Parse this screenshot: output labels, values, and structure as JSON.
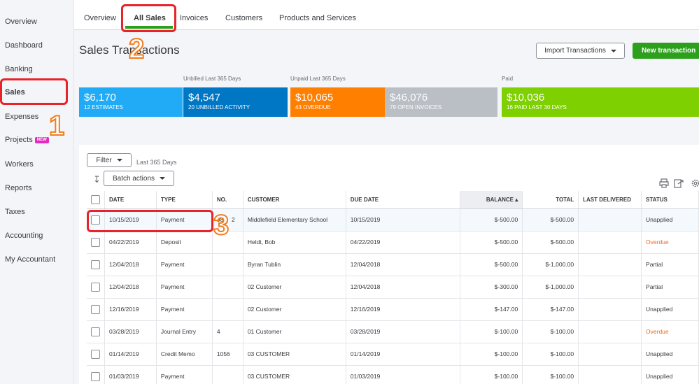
{
  "sidebar": {
    "items": [
      {
        "label": "Overview"
      },
      {
        "label": "Dashboard"
      },
      {
        "label": "Banking"
      },
      {
        "label": "Sales"
      },
      {
        "label": "Expenses"
      },
      {
        "label": "Projects",
        "badge": "NEW"
      },
      {
        "label": "Workers"
      },
      {
        "label": "Reports"
      },
      {
        "label": "Taxes"
      },
      {
        "label": "Accounting"
      },
      {
        "label": "My Accountant"
      }
    ]
  },
  "tabs": [
    "Overview",
    "All Sales",
    "Invoices",
    "Customers",
    "Products and Services"
  ],
  "page": {
    "title": "Sales Transactions",
    "import_label": "Import Transactions",
    "new_label": "New transaction"
  },
  "money_bar": {
    "labels": {
      "unbilled": "Unbilled Last 365 Days",
      "unpaid": "Unpaid Last 365 Days",
      "paid": "Paid"
    },
    "cards": [
      {
        "amount": "$6,170",
        "sub": "12 ESTIMATES",
        "color": "#21abf6"
      },
      {
        "amount": "$4,547",
        "sub": "20 UNBILLED ACTIVITY",
        "color": "#0077c5"
      },
      {
        "amount": "$10,065",
        "sub": "43 OVERDUE",
        "color": "#ff8000"
      },
      {
        "amount": "$46,076",
        "sub": "79 OPEN INVOICES",
        "color": "#babec5"
      },
      {
        "amount": "$10,036",
        "sub": "16 PAID LAST 30 DAYS",
        "color": "#7fd000"
      }
    ]
  },
  "filter": {
    "label": "Filter",
    "range": "Last 365 Days",
    "batch_label": "Batch actions"
  },
  "table": {
    "headers": {
      "date": "DATE",
      "type": "TYPE",
      "no": "NO.",
      "customer": "CUSTOMER",
      "due": "DUE DATE",
      "balance": "BALANCE",
      "total": "TOTAL",
      "delivered": "LAST DELIVERED",
      "status": "STATUS"
    },
    "rows": [
      {
        "date": "10/15/2019",
        "type": "Payment",
        "no": "980",
        "no_suffix": "2",
        "customer": "Middlefield Elementary School",
        "due": "10/15/2019",
        "balance": "$-500.00",
        "total": "$-500.00",
        "delivered": "",
        "status": "Unapplied"
      },
      {
        "date": "04/22/2019",
        "type": "Deposit",
        "no": "",
        "customer": "Heldt, Bob",
        "due": "04/22/2019",
        "balance": "$-500.00",
        "total": "$-500.00",
        "delivered": "",
        "status": "Overdue"
      },
      {
        "date": "12/04/2018",
        "type": "Payment",
        "no": "",
        "customer": "Byran Tublin",
        "due": "12/04/2018",
        "balance": "$-500.00",
        "total": "$-1,000.00",
        "delivered": "",
        "status": "Partial"
      },
      {
        "date": "12/04/2018",
        "type": "Payment",
        "no": "",
        "customer": "02 Customer",
        "due": "12/04/2018",
        "balance": "$-300.00",
        "total": "$-1,000.00",
        "delivered": "",
        "status": "Partial"
      },
      {
        "date": "12/16/2019",
        "type": "Payment",
        "no": "",
        "customer": "02 Customer",
        "due": "12/16/2019",
        "balance": "$-147.00",
        "total": "$-147.00",
        "delivered": "",
        "status": "Unapplied"
      },
      {
        "date": "03/28/2019",
        "type": "Journal Entry",
        "no": "4",
        "customer": "01 Customer",
        "due": "03/28/2019",
        "balance": "$-100.00",
        "total": "$-100.00",
        "delivered": "",
        "status": "Overdue"
      },
      {
        "date": "01/14/2019",
        "type": "Credit Memo",
        "no": "1056",
        "customer": "03 CUSTOMER",
        "due": "01/14/2019",
        "balance": "$-100.00",
        "total": "$-100.00",
        "delivered": "",
        "status": "Unapplied"
      },
      {
        "date": "01/03/2019",
        "type": "Payment",
        "no": "",
        "customer": "03 CUSTOMER",
        "due": "01/03/2019",
        "balance": "$-100.00",
        "total": "$-100.00",
        "delivered": "",
        "status": "Unapplied"
      }
    ]
  },
  "annotations": [
    "1",
    "2",
    "3"
  ],
  "colors": {
    "accent_green": "#2ca01c",
    "highlight_red": "#e8232a",
    "annotation_orange": "#f07d1c",
    "overdue": "#ec6a24"
  }
}
